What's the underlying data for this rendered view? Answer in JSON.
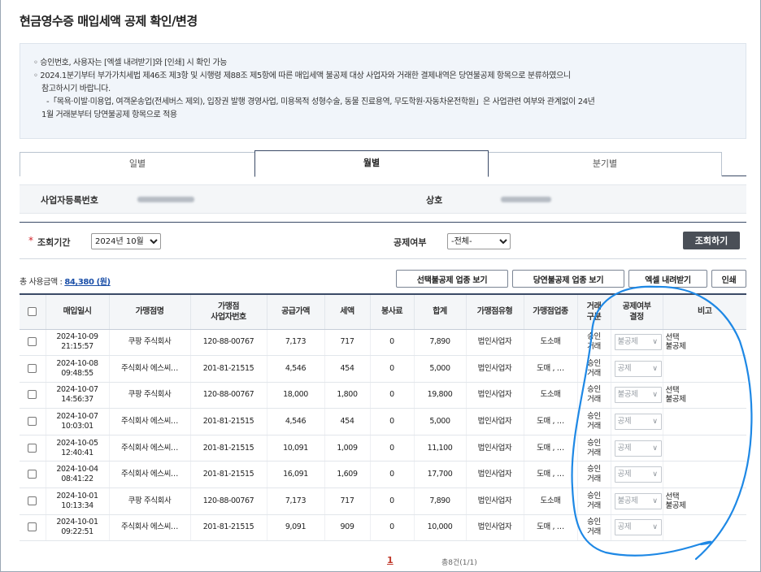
{
  "page_title": "현금영수증 매입세액 공제 확인/변경",
  "notice": {
    "line1": "◦ 승인번호, 사용자는 [엑셀 내려받기]와 [인쇄] 시 확인 가능",
    "line2": "◦ 2024.1분기부터 부가가치세법 제46조 제3항 및 시행령 제88조 제5항에 따른 매입세액 불공제 대상 사업자와 거래한 결제내역은 당연불공제 항목으로 분류하였으니",
    "line3": "참고하시기 바랍니다.",
    "line4": "-「목욕·이발·미용업, 여객운송업(전세버스 제외), 입장권 발행 경영사업, 미용목적 성형수술, 동물 진료용역, 무도학원·자동차운전학원」은 사업관련 여부와 관계없이 24년",
    "line5": "1월 거래분부터 당연불공제 항목으로 적용"
  },
  "tabs": [
    "일별",
    "월별",
    "분기별"
  ],
  "business": {
    "reg_no_label": "사업자등록번호",
    "company_label": "상호"
  },
  "search": {
    "period_label": "조회기간",
    "period_value": "2024년 10월",
    "deduct_label": "공제여부",
    "deduct_value": "-전체-",
    "query_button": "조회하기"
  },
  "summary": {
    "total_label": "총 사용금액 : ",
    "total_amount": "84,380 (원)"
  },
  "actions": {
    "optional_btn": "선택불공제 업종 보기",
    "mandatory_btn": "당연불공제 업종 보기",
    "excel_btn": "엑셀 내려받기",
    "print_btn": "인쇄"
  },
  "table": {
    "headers": {
      "date": "매입일시",
      "merchant": "가맹점명",
      "biz_no": "가맹점\n사업자번호",
      "supply": "공급가액",
      "tax": "세액",
      "tip": "봉사료",
      "total": "합계",
      "mtype": "가맹점유형",
      "industry": "가맹점업종",
      "txtype": "거래\n구분",
      "deduct": "공제여부\n결정",
      "remark": "비고"
    },
    "rows": [
      {
        "date": "2024-10-09",
        "time": "21:15:57",
        "merchant": "쿠팡 주식회사",
        "biz_no": "120-88-00767",
        "supply": "7,173",
        "tax": "717",
        "tip": "0",
        "total": "7,890",
        "mtype": "법인사업자",
        "industry": "도소매",
        "tx1": "승인",
        "tx2": "거래",
        "deduct": "불공제",
        "remark1": "선택",
        "remark2": "불공제"
      },
      {
        "date": "2024-10-08",
        "time": "09:48:55",
        "merchant": "주식회사 에스씨…",
        "biz_no": "201-81-21515",
        "supply": "4,546",
        "tax": "454",
        "tip": "0",
        "total": "5,000",
        "mtype": "법인사업자",
        "industry": "도매 , …",
        "tx1": "승인",
        "tx2": "거래",
        "deduct": "공제",
        "remark1": "",
        "remark2": ""
      },
      {
        "date": "2024-10-07",
        "time": "14:56:37",
        "merchant": "쿠팡 주식회사",
        "biz_no": "120-88-00767",
        "supply": "18,000",
        "tax": "1,800",
        "tip": "0",
        "total": "19,800",
        "mtype": "법인사업자",
        "industry": "도소매",
        "tx1": "승인",
        "tx2": "거래",
        "deduct": "불공제",
        "remark1": "선택",
        "remark2": "불공제"
      },
      {
        "date": "2024-10-07",
        "time": "10:03:01",
        "merchant": "주식회사 에스씨…",
        "biz_no": "201-81-21515",
        "supply": "4,546",
        "tax": "454",
        "tip": "0",
        "total": "5,000",
        "mtype": "법인사업자",
        "industry": "도매 , …",
        "tx1": "승인",
        "tx2": "거래",
        "deduct": "공제",
        "remark1": "",
        "remark2": ""
      },
      {
        "date": "2024-10-05",
        "time": "12:40:41",
        "merchant": "주식회사 에스씨…",
        "biz_no": "201-81-21515",
        "supply": "10,091",
        "tax": "1,009",
        "tip": "0",
        "total": "11,100",
        "mtype": "법인사업자",
        "industry": "도매 , …",
        "tx1": "승인",
        "tx2": "거래",
        "deduct": "공제",
        "remark1": "",
        "remark2": ""
      },
      {
        "date": "2024-10-04",
        "time": "08:41:22",
        "merchant": "주식회사 에스씨…",
        "biz_no": "201-81-21515",
        "supply": "16,091",
        "tax": "1,609",
        "tip": "0",
        "total": "17,700",
        "mtype": "법인사업자",
        "industry": "도매 , …",
        "tx1": "승인",
        "tx2": "거래",
        "deduct": "공제",
        "remark1": "",
        "remark2": ""
      },
      {
        "date": "2024-10-01",
        "time": "10:13:34",
        "merchant": "쿠팡 주식회사",
        "biz_no": "120-88-00767",
        "supply": "7,173",
        "tax": "717",
        "tip": "0",
        "total": "7,890",
        "mtype": "법인사업자",
        "industry": "도소매",
        "tx1": "승인",
        "tx2": "거래",
        "deduct": "불공제",
        "remark1": "선택",
        "remark2": "불공제"
      },
      {
        "date": "2024-10-01",
        "time": "09:22:51",
        "merchant": "주식회사 에스씨…",
        "biz_no": "201-81-21515",
        "supply": "9,091",
        "tax": "909",
        "tip": "0",
        "total": "10,000",
        "mtype": "법인사업자",
        "industry": "도매 , …",
        "tx1": "승인",
        "tx2": "거래",
        "deduct": "공제",
        "remark1": "",
        "remark2": ""
      }
    ]
  },
  "pagination": {
    "current_page": "1",
    "info": "총8건(1/1)"
  },
  "colors": {
    "accent_dark": "#3a4a66",
    "link_blue": "#1b4fa8",
    "required_red": "#d2232a",
    "annotation_blue": "#1e88e5"
  }
}
